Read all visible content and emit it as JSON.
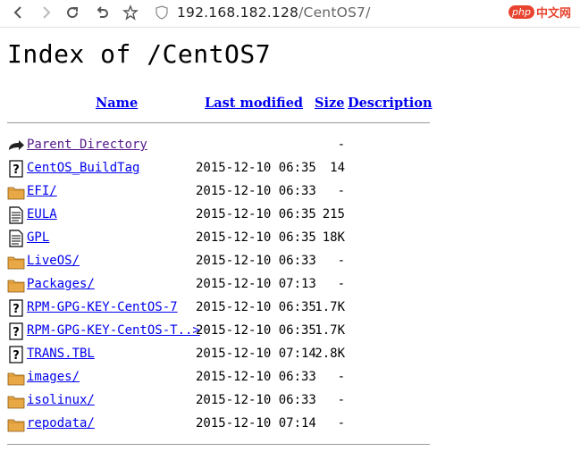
{
  "browser": {
    "url_host": "192.168.182.128",
    "url_path": "/CentOS7/",
    "ext_badge": "php",
    "ext_label": "中文网",
    "icons": [
      "back-icon",
      "forward-icon",
      "reload-icon",
      "undo-icon",
      "star-icon",
      "shield-icon"
    ]
  },
  "page": {
    "title": "Index of /CentOS7",
    "columns": {
      "name": "Name",
      "last_modified": "Last modified",
      "size": "Size",
      "description": "Description"
    },
    "rows": [
      {
        "icon": "back-folder-icon",
        "name": "Parent Directory",
        "date": "",
        "size": "-",
        "desc": "",
        "visited": true
      },
      {
        "icon": "unknown-file-icon",
        "name": "CentOS_BuildTag",
        "date": "2015-12-10 06:35",
        "size": "14",
        "desc": ""
      },
      {
        "icon": "folder-icon",
        "name": "EFI/",
        "date": "2015-12-10 06:33",
        "size": "-",
        "desc": ""
      },
      {
        "icon": "text-file-icon",
        "name": "EULA",
        "date": "2015-12-10 06:35",
        "size": "215",
        "desc": ""
      },
      {
        "icon": "text-file-icon",
        "name": "GPL",
        "date": "2015-12-10 06:35",
        "size": "18K",
        "desc": ""
      },
      {
        "icon": "folder-icon",
        "name": "LiveOS/",
        "date": "2015-12-10 06:33",
        "size": "-",
        "desc": ""
      },
      {
        "icon": "folder-icon",
        "name": "Packages/",
        "date": "2015-12-10 07:13",
        "size": "-",
        "desc": ""
      },
      {
        "icon": "unknown-file-icon",
        "name": "RPM-GPG-KEY-CentOS-7",
        "date": "2015-12-10 06:35",
        "size": "1.7K",
        "desc": ""
      },
      {
        "icon": "unknown-file-icon",
        "name": "RPM-GPG-KEY-CentOS-T..>",
        "date": "2015-12-10 06:35",
        "size": "1.7K",
        "desc": ""
      },
      {
        "icon": "unknown-file-icon",
        "name": "TRANS.TBL",
        "date": "2015-12-10 07:14",
        "size": "2.8K",
        "desc": ""
      },
      {
        "icon": "folder-icon",
        "name": "images/",
        "date": "2015-12-10 06:33",
        "size": "-",
        "desc": ""
      },
      {
        "icon": "folder-icon",
        "name": "isolinux/",
        "date": "2015-12-10 06:33",
        "size": "-",
        "desc": ""
      },
      {
        "icon": "folder-icon",
        "name": "repodata/",
        "date": "2015-12-10 07:14",
        "size": "-",
        "desc": ""
      }
    ]
  },
  "colors": {
    "link": "#0000ee",
    "visited_link": "#551a8b",
    "folder": "#e8a845",
    "ext_brand": "#e8432e"
  }
}
